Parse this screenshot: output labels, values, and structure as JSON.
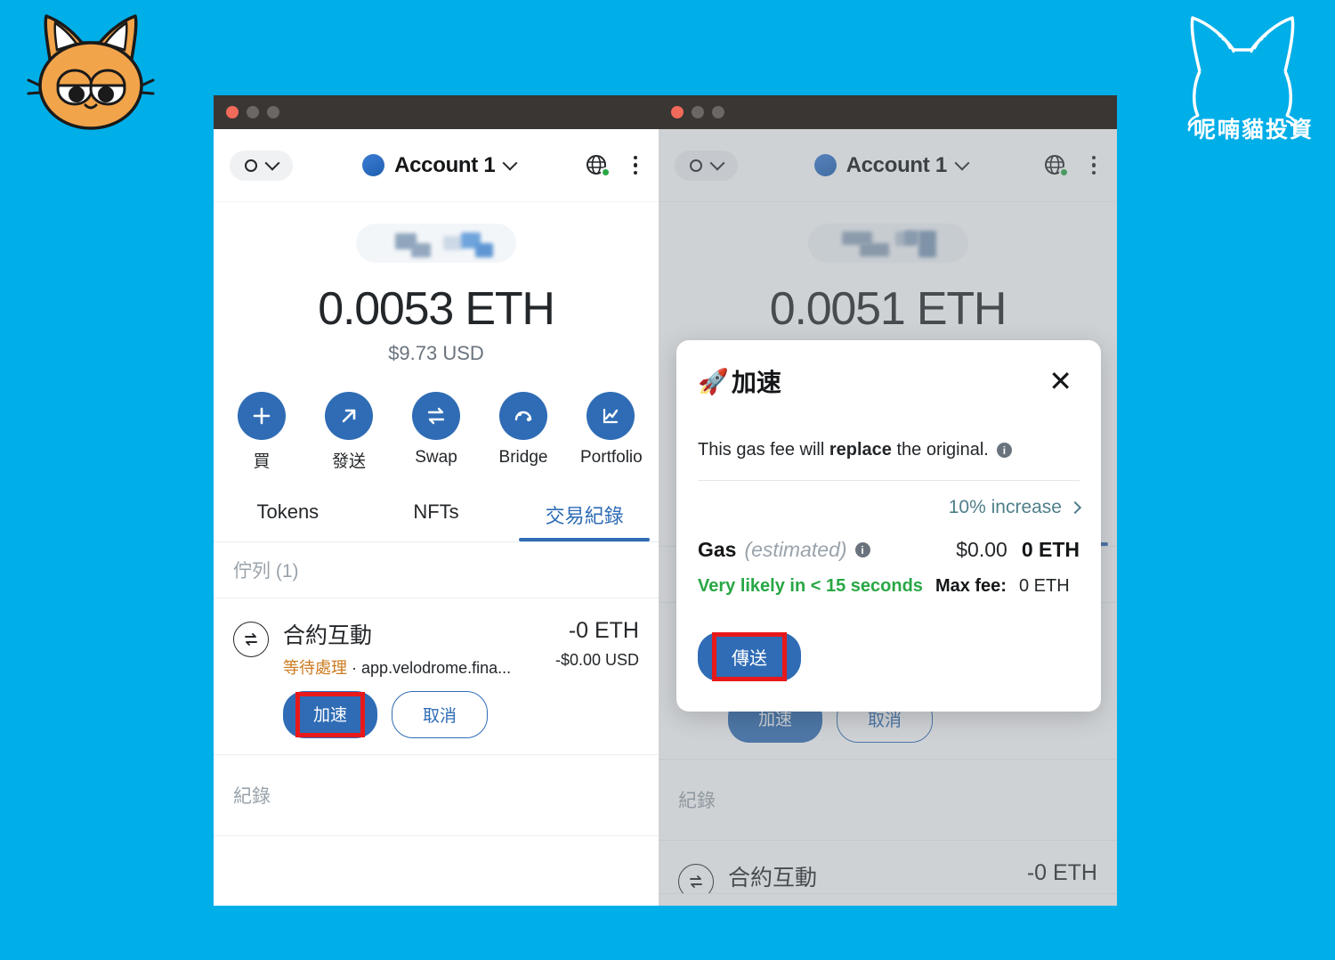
{
  "brand": {
    "logo_name": "cat-face-logo",
    "watermark_name": "cat-outline-watermark",
    "watermark_text": "呢喃貓投資",
    "background_color": "#00AEE8"
  },
  "wallet": {
    "network_selector": {
      "icon": "circle-icon",
      "chevron": "chevron-down-icon"
    },
    "account_name": "Account 1",
    "account_chevron": "chevron-down-icon",
    "globe_icon": "globe-icon",
    "menu_icon": "kebab-menu-icon",
    "address_pill": "blurred-address",
    "actions": [
      {
        "label": "買",
        "icon": "plus-icon"
      },
      {
        "label": "發送",
        "icon": "arrow-up-right-icon"
      },
      {
        "label": "Swap",
        "icon": "swap-arrows-icon"
      },
      {
        "label": "Bridge",
        "icon": "bridge-arc-icon"
      },
      {
        "label": "Portfolio",
        "icon": "chart-line-icon"
      }
    ],
    "tabs": [
      {
        "label": "Tokens",
        "active": false
      },
      {
        "label": "NFTs",
        "active": false
      },
      {
        "label": "交易紀錄",
        "active": true
      }
    ],
    "queued_header": "佇列 (1)",
    "history_header": "紀錄",
    "transaction": {
      "icon": "contract-interaction-icon",
      "title": "合約互動",
      "status": "等待處理",
      "separator": "·",
      "origin": "app.velodrome.fina...",
      "amount_eth": "-0 ETH",
      "amount_usd": "-$0.00 USD",
      "speedup_label": "加速",
      "cancel_label": "取消"
    }
  },
  "window_left": {
    "balance_eth": "0.0053 ETH",
    "balance_usd": "$9.73 USD"
  },
  "window_right": {
    "balance_eth": "0.0051 ETH"
  },
  "modal": {
    "emoji": "🚀",
    "title": "加速",
    "close_icon": "close-x-icon",
    "note_prefix": "This gas fee will ",
    "note_bold": "replace",
    "note_suffix": " the original.",
    "info_icon": "info-icon",
    "increase_label": "10% increase",
    "increase_chevron": "chevron-right-icon",
    "gas_label": "Gas",
    "gas_estimated": "(estimated)",
    "gas_usd": "$0.00",
    "gas_eth": "0 ETH",
    "speed_text": "Very likely in < 15 seconds",
    "max_fee_label": "Max fee:",
    "max_fee_value": "0 ETH",
    "send_label": "傳送"
  },
  "colors": {
    "accent_blue": "#2f6cb5",
    "highlight_red": "#e8191b",
    "pending_orange": "#cc7a1e",
    "success_green": "#28a745",
    "link_teal": "#4f7f8a"
  }
}
